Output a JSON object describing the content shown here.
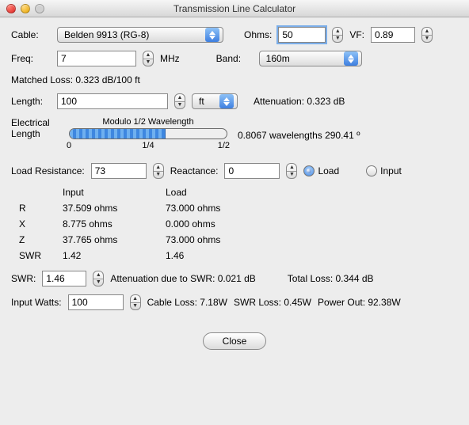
{
  "window": {
    "title": "Transmission Line Calculator"
  },
  "row1": {
    "cable_label": "Cable:",
    "cable_value": "Belden 9913 (RG-8)",
    "ohms_label": "Ohms:",
    "ohms_value": "50",
    "vf_label": "VF:",
    "vf_value": "0.89"
  },
  "row2": {
    "freq_label": "Freq:",
    "freq_value": "7",
    "freq_unit": "MHz",
    "band_label": "Band:",
    "band_value": "160m"
  },
  "matched_loss": "Matched Loss: 0.323 dB/100 ft",
  "row3": {
    "length_label": "Length:",
    "length_value": "100",
    "unit_value": "ft",
    "attenuation": "Attenuation: 0.323 dB"
  },
  "elec": {
    "label_line1": "Electrical",
    "label_line2": "Length",
    "gauge_title": "Modulo 1/2 Wavelength",
    "gauge_fill_pct": 61,
    "tick0": "0",
    "tick1": "1/4",
    "tick2": "1/2",
    "readout": "0.8067 wavelengths  290.41 º"
  },
  "row4": {
    "loadres_label": "Load Resistance:",
    "loadres_value": "73",
    "reactance_label": "Reactance:",
    "reactance_value": "0",
    "load_radio": "Load",
    "input_radio": "Input"
  },
  "grid": {
    "col_input": "Input",
    "col_load": "Load",
    "row_r": "R",
    "row_x": "X",
    "row_z": "Z",
    "row_swr": "SWR",
    "r_input": "37.509 ohms",
    "r_load": "73.000 ohms",
    "x_input": "8.775 ohms",
    "x_load": "0.000 ohms",
    "z_input": "37.765 ohms",
    "z_load": "73.000 ohms",
    "swr_input": "1.42",
    "swr_load": "1.46"
  },
  "row5": {
    "swr_label": "SWR:",
    "swr_value": "1.46",
    "att_swr": "Attenuation due to SWR:  0.021 dB",
    "total_loss": "Total Loss: 0.344 dB"
  },
  "row6": {
    "watts_label": "Input Watts:",
    "watts_value": "100",
    "cable_loss": "Cable Loss: 7.18W",
    "swr_loss": "SWR Loss: 0.45W",
    "power_out": "Power Out: 92.38W"
  },
  "close_btn": "Close"
}
